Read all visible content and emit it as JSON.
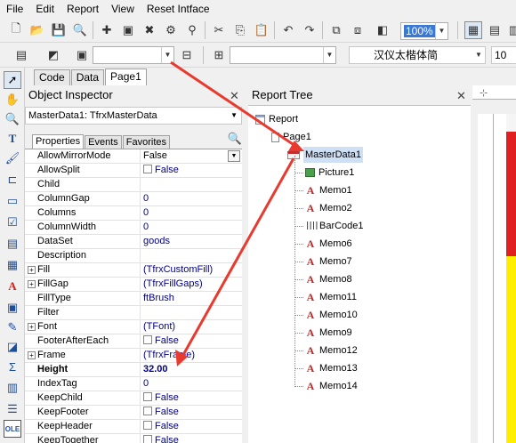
{
  "menu": [
    "File",
    "Edit",
    "Report",
    "View",
    "Reset Intface"
  ],
  "toolbar1": {
    "zoom": "100%"
  },
  "toolbar2": {
    "font_name": "汉仪太楷体简",
    "font_size": "10"
  },
  "page_tabs": [
    "Code",
    "Data",
    "Page1"
  ],
  "inspector": {
    "title": "Object Inspector",
    "selected_object": "MasterData1: TfrxMasterData",
    "tabs": [
      "Properties",
      "Events",
      "Favorites"
    ],
    "properties": [
      {
        "name": "AllowMirrorMode",
        "value": "False",
        "type": "dropdown"
      },
      {
        "name": "AllowSplit",
        "value": "False",
        "type": "check"
      },
      {
        "name": "Child",
        "value": ""
      },
      {
        "name": "ColumnGap",
        "value": "0"
      },
      {
        "name": "Columns",
        "value": "0"
      },
      {
        "name": "ColumnWidth",
        "value": "0"
      },
      {
        "name": "DataSet",
        "value": "goods"
      },
      {
        "name": "Description",
        "value": ""
      },
      {
        "name": "Fill",
        "value": "(TfrxCustomFill)",
        "expand": true
      },
      {
        "name": "FillGap",
        "value": "(TfrxFillGaps)",
        "expand": true
      },
      {
        "name": "FillType",
        "value": "ftBrush"
      },
      {
        "name": "Filter",
        "value": ""
      },
      {
        "name": "Font",
        "value": "(TFont)",
        "expand": true
      },
      {
        "name": "FooterAfterEach",
        "value": "False",
        "type": "check"
      },
      {
        "name": "Frame",
        "value": "(TfrxFrame)",
        "expand": true
      },
      {
        "name": "Height",
        "value": "32.00",
        "bold": true
      },
      {
        "name": "IndexTag",
        "value": "0"
      },
      {
        "name": "KeepChild",
        "value": "False",
        "type": "check"
      },
      {
        "name": "KeepFooter",
        "value": "False",
        "type": "check"
      },
      {
        "name": "KeepHeader",
        "value": "False",
        "type": "check"
      },
      {
        "name": "KeepTogether",
        "value": "False",
        "type": "check"
      }
    ]
  },
  "report_tree": {
    "title": "Report Tree",
    "nodes": [
      {
        "label": "Report",
        "icon": "report",
        "level": 0
      },
      {
        "label": "Page1",
        "icon": "page",
        "level": 1
      },
      {
        "label": "MasterData1",
        "icon": "band",
        "level": 2,
        "selected": true
      },
      {
        "label": "Picture1",
        "icon": "pic",
        "level": 3
      },
      {
        "label": "Memo1",
        "icon": "memo",
        "level": 3
      },
      {
        "label": "Memo2",
        "icon": "memo",
        "level": 3
      },
      {
        "label": "BarCode1",
        "icon": "bar",
        "level": 3
      },
      {
        "label": "Memo6",
        "icon": "memo",
        "level": 3
      },
      {
        "label": "Memo7",
        "icon": "memo",
        "level": 3
      },
      {
        "label": "Memo8",
        "icon": "memo",
        "level": 3
      },
      {
        "label": "Memo11",
        "icon": "memo",
        "level": 3
      },
      {
        "label": "Memo10",
        "icon": "memo",
        "level": 3
      },
      {
        "label": "Memo9",
        "icon": "memo",
        "level": 3
      },
      {
        "label": "Memo12",
        "icon": "memo",
        "level": 3
      },
      {
        "label": "Memo13",
        "icon": "memo",
        "level": 3
      },
      {
        "label": "Memo14",
        "icon": "memo",
        "level": 3
      }
    ]
  },
  "designer": {
    "band_color_top": "#e02020",
    "band_color_bottom": "#ffee00"
  },
  "arrow_color": "#e83a2e"
}
